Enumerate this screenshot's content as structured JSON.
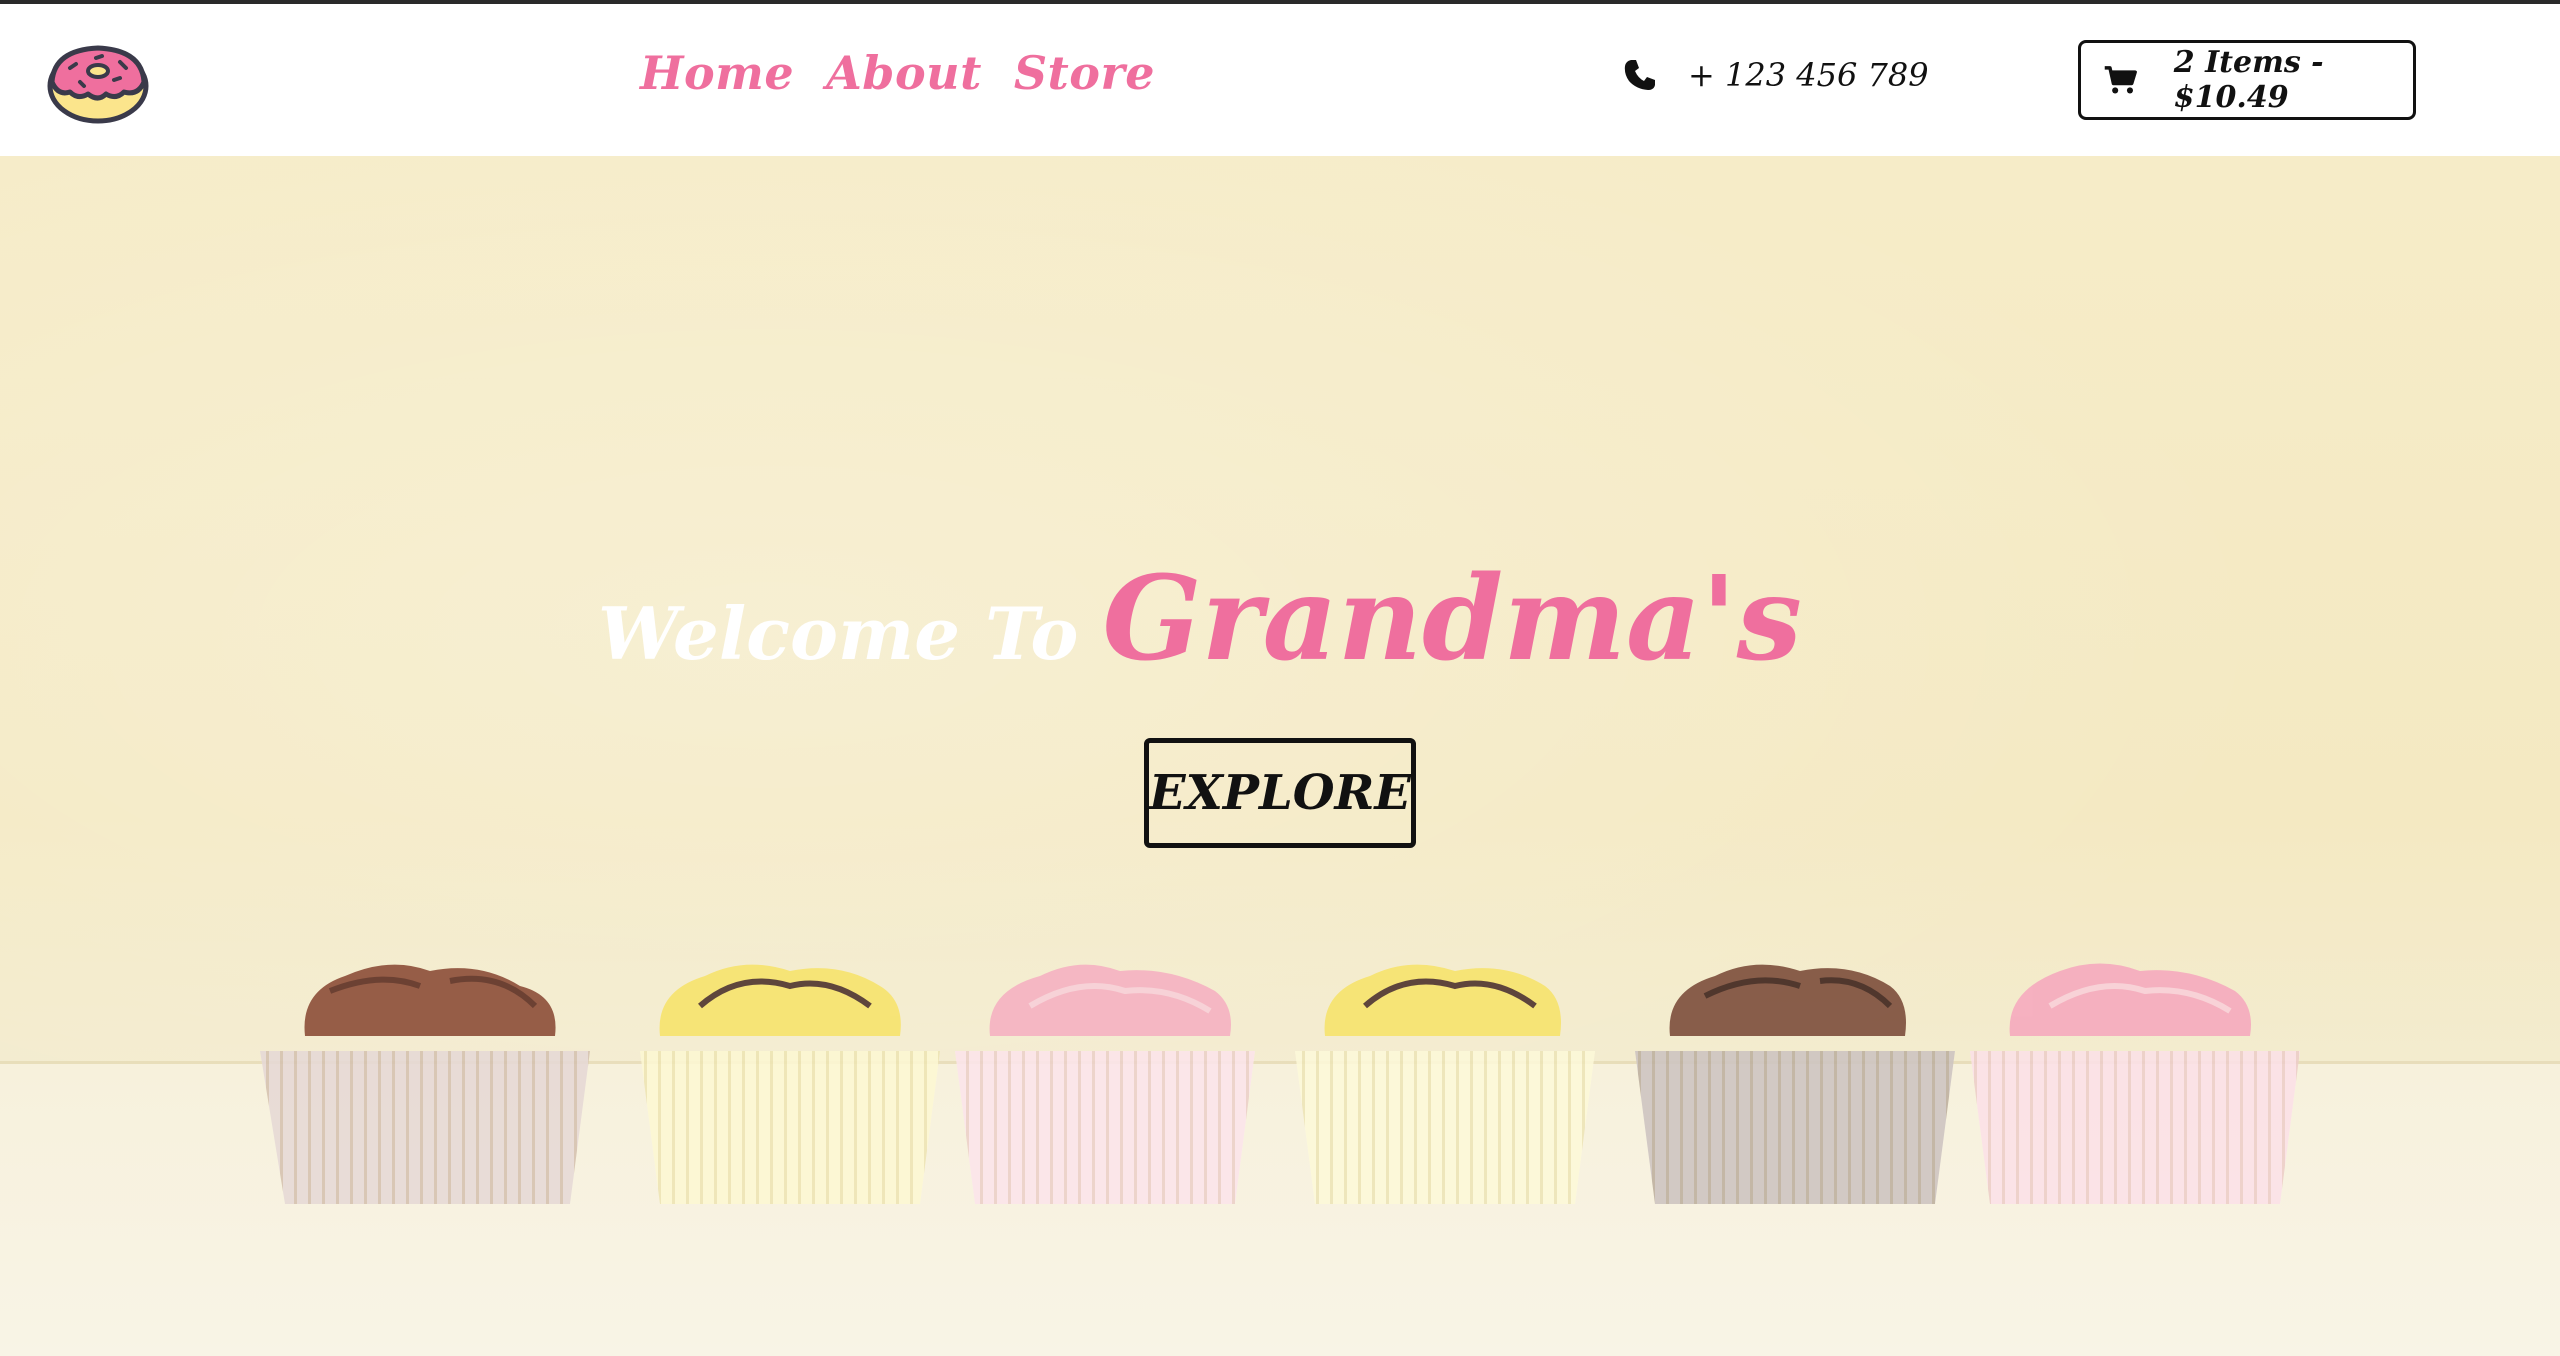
{
  "colors": {
    "accent_pink": "#ef6f9e",
    "text_dark": "#111111",
    "header_bg": "#ffffff",
    "hero_bg": "#f5ecc8"
  },
  "header": {
    "logo_icon": "donut-icon",
    "nav": [
      {
        "label": "Home"
      },
      {
        "label": "About"
      },
      {
        "label": "Store"
      }
    ],
    "phone_icon": "phone-icon",
    "phone": "+ 123 456 789",
    "cart_icon": "shopping-cart-icon",
    "cart_label": "2 Items - $10.49"
  },
  "hero": {
    "welcome_prefix": "Welcome To",
    "brand": "Grandma's",
    "explore_label": "EXPLORE"
  }
}
